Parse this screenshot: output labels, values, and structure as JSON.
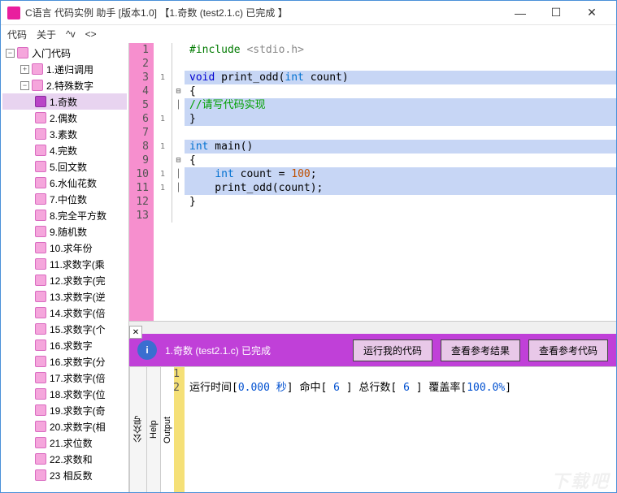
{
  "window": {
    "title": "C语言 代码实例 助手 [版本1.0] 【1.奇数 (test2.1.c) 已完成 】"
  },
  "menu": {
    "code": "代码",
    "about": "关于",
    "up": "^v",
    "nav": "<>"
  },
  "tree": {
    "root": "入门代码",
    "g1": "1.递归调用",
    "g2": "2.特殊数字",
    "items": [
      "1.奇数",
      "2.偶数",
      "3.素数",
      "4.完数",
      "5.回文数",
      "6.水仙花数",
      "7.中位数",
      "8.完全平方数",
      "9.随机数",
      "10.求年份",
      "11.求数字(乘",
      "12.求数字(完",
      "13.求数字(逆",
      "14.求数字(倍",
      "15.求数字(个",
      "16.求数字",
      "16.求数字(分",
      "17.求数字(倍",
      "18.求数字(位",
      "19.求数字(奇",
      "20.求数字(相",
      "21.求位数",
      "22.求数和",
      "23 相反数"
    ]
  },
  "code": {
    "lines": [
      {
        "n": 1,
        "m": "",
        "f": "",
        "hl": false,
        "html": "<span class='inc'>#include</span> <span class='str'>&lt;stdio.h&gt;</span>"
      },
      {
        "n": 2,
        "m": "",
        "f": "",
        "hl": false,
        "html": ""
      },
      {
        "n": 3,
        "m": "1",
        "f": "",
        "hl": true,
        "html": "<span class='kw'>void</span> print_odd(<span class='type'>int</span> count)"
      },
      {
        "n": 4,
        "m": "",
        "f": "⊟",
        "hl": false,
        "html": "{"
      },
      {
        "n": 5,
        "m": "",
        "f": "│",
        "hl": true,
        "html": "<span class='cmt'>//请写代码实现</span>"
      },
      {
        "n": 6,
        "m": "1",
        "f": "",
        "hl": true,
        "html": "}"
      },
      {
        "n": 7,
        "m": "",
        "f": "",
        "hl": false,
        "html": ""
      },
      {
        "n": 8,
        "m": "1",
        "f": "",
        "hl": true,
        "html": "<span class='type'>int</span> main()"
      },
      {
        "n": 9,
        "m": "",
        "f": "⊟",
        "hl": false,
        "html": "{"
      },
      {
        "n": 10,
        "m": "1",
        "f": "│",
        "hl": true,
        "html": "    <span class='type'>int</span> count = <span class='num'>100</span>;"
      },
      {
        "n": 11,
        "m": "1",
        "f": "│",
        "hl": true,
        "html": "    print_odd(count);"
      },
      {
        "n": 12,
        "m": "",
        "f": "",
        "hl": false,
        "html": "}"
      },
      {
        "n": 13,
        "m": "",
        "f": "",
        "hl": false,
        "html": ""
      }
    ]
  },
  "actionbar": {
    "status": "1.奇数 (test2.1.c) 已完成",
    "btn_run": "运行我的代码",
    "btn_ref_out": "查看参考结果",
    "btn_ref_code": "查看参考代码"
  },
  "vtabs": {
    "t1": "公众号",
    "t2": "Help",
    "t3": "Output"
  },
  "output": {
    "line1": "",
    "parts": {
      "p1": "运行时间[",
      "v1": "0.000 秒",
      "p2": "] 命中[ ",
      "v2": "6",
      "p3": " ] 总行数[ ",
      "v3": "6",
      "p4": " ] 覆盖率[",
      "v4": "100.0%",
      "p5": "]"
    }
  },
  "watermark": "下载吧"
}
